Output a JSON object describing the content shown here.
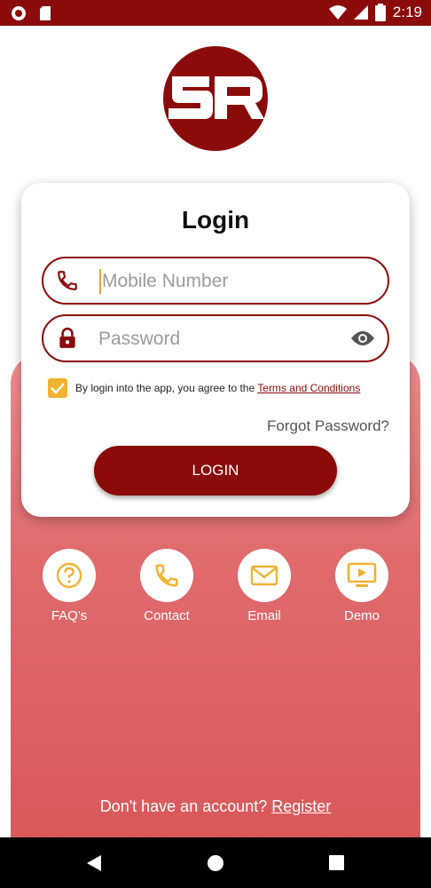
{
  "status_bar": {
    "time": "2:19"
  },
  "logo": {
    "text": "SR"
  },
  "login_card": {
    "title": "Login",
    "mobile_placeholder": "Mobile Number",
    "password_placeholder": "Password",
    "terms_prefix": "By login into the app, you agree to the ",
    "terms_link": "Terms and Conditions",
    "terms_checked": true,
    "forgot_password": "Forgot Password?",
    "login_button": "LOGIN"
  },
  "quick_actions": [
    {
      "label": "FAQ's",
      "icon": "question-icon"
    },
    {
      "label": "Contact",
      "icon": "phone-icon"
    },
    {
      "label": "Email",
      "icon": "mail-icon"
    },
    {
      "label": "Demo",
      "icon": "play-screen-icon"
    }
  ],
  "register": {
    "prompt": "Don't have an account? ",
    "link": "Register"
  },
  "colors": {
    "brand": "#8b0a0a",
    "accent": "#f0b232",
    "panel_top": "#ef8f90",
    "panel_bottom": "#d9585a"
  }
}
